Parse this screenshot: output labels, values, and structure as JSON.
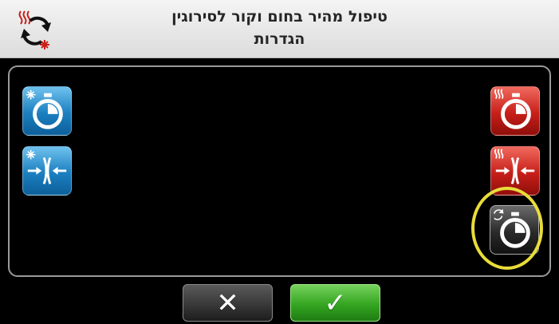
{
  "header": {
    "title_line1": "טיפול מהיר בחום וקור לסירוגין",
    "title_line2": "הגדרות",
    "mode_icon": "heat-cold-cycle-icon"
  },
  "buttons": {
    "cold_timer": {
      "icon": "snowflake-timer-icon",
      "color": "#1b7fc0"
    },
    "cold_compress": {
      "icon": "snowflake-compress-icon",
      "color": "#1b7fc0"
    },
    "heat_timer": {
      "icon": "heat-timer-icon",
      "color": "#c71f19"
    },
    "heat_compress": {
      "icon": "heat-compress-icon",
      "color": "#c71f19"
    },
    "cycle_timer": {
      "icon": "cycle-timer-icon",
      "color": "#2a2a2a",
      "highlighted": true
    }
  },
  "footer": {
    "cancel_symbol": "✕",
    "confirm_symbol": "✓"
  },
  "colors": {
    "highlight_ring": "#e8dc3a",
    "confirm_green": "#34a521"
  }
}
